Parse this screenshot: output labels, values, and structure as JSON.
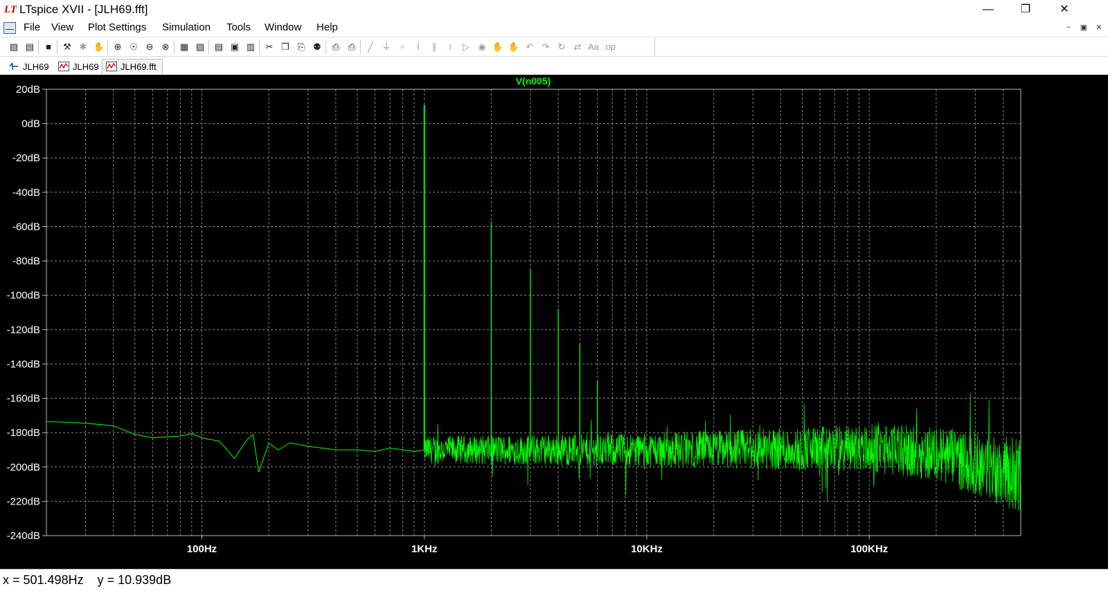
{
  "window": {
    "title": "LTspice XVII - [JLH69.fft]",
    "app_logo": "LT",
    "minimize": "—",
    "restore": "❐",
    "close": "✕"
  },
  "menu": {
    "items": [
      "File",
      "View",
      "Plot Settings",
      "Simulation",
      "Tools",
      "Window",
      "Help"
    ],
    "mdi_minimize": "–",
    "mdi_restore": "▣",
    "mdi_close": "✕"
  },
  "toolbar": {
    "buttons": [
      {
        "icon": "new-schematic-icon",
        "glyph": "▨"
      },
      {
        "icon": "open-icon",
        "glyph": "▤"
      },
      {
        "icon": "save-icon",
        "glyph": "■"
      },
      {
        "icon": "control-panel-icon",
        "glyph": "⚒"
      },
      {
        "icon": "run-icon",
        "glyph": "✱"
      },
      {
        "icon": "halt-icon",
        "glyph": "✋"
      },
      {
        "icon": "zoom-area-icon",
        "glyph": "⊕"
      },
      {
        "icon": "pan-icon",
        "glyph": "☉"
      },
      {
        "icon": "zoom-out-icon",
        "glyph": "⊖"
      },
      {
        "icon": "zoom-fit-icon",
        "glyph": "⊗"
      },
      {
        "icon": "autorange-icon",
        "glyph": "▦"
      },
      {
        "icon": "pick-visible-traces-icon",
        "glyph": "▧"
      },
      {
        "icon": "tile-horizontal-icon",
        "glyph": "▤"
      },
      {
        "icon": "cascade-icon",
        "glyph": "▣"
      },
      {
        "icon": "tile-vertical-icon",
        "glyph": "▥"
      },
      {
        "icon": "cut-icon",
        "glyph": "✂"
      },
      {
        "icon": "copy-icon",
        "glyph": "❐"
      },
      {
        "icon": "paste-icon",
        "glyph": "⎘"
      },
      {
        "icon": "find-icon",
        "glyph": "⚉"
      },
      {
        "icon": "print-preview-icon",
        "glyph": "⎙"
      },
      {
        "icon": "print-icon",
        "glyph": "⎙"
      },
      {
        "icon": "wire-icon",
        "glyph": "╱"
      },
      {
        "icon": "ground-icon",
        "glyph": "⏚"
      },
      {
        "icon": "label-net-icon",
        "glyph": "▫"
      },
      {
        "icon": "resistor-icon",
        "glyph": "⌇"
      },
      {
        "icon": "capacitor-icon",
        "glyph": "∥"
      },
      {
        "icon": "inductor-icon",
        "glyph": "≀"
      },
      {
        "icon": "diode-icon",
        "glyph": "▷"
      },
      {
        "icon": "component-icon",
        "glyph": "◉"
      },
      {
        "icon": "move-icon",
        "glyph": "✋"
      },
      {
        "icon": "drag-icon",
        "glyph": "✋"
      },
      {
        "icon": "undo-icon",
        "glyph": "↶"
      },
      {
        "icon": "redo-icon",
        "glyph": "↷"
      },
      {
        "icon": "rotate-icon",
        "glyph": "↻"
      },
      {
        "icon": "mirror-icon",
        "glyph": "⇄"
      },
      {
        "icon": "text-icon",
        "glyph": "Aa"
      },
      {
        "icon": "spice-directive-icon",
        "glyph": ".op"
      }
    ]
  },
  "tabs": [
    {
      "label": "JLH69",
      "icon": "schematic-icon"
    },
    {
      "label": "JLH69",
      "icon": "waveform-icon"
    },
    {
      "label": "JLH69.fft",
      "icon": "waveform-icon"
    }
  ],
  "colors": {
    "trace": "#00ff00",
    "grid": "#8a8a8a",
    "axis_text": "#ffffff",
    "plot_bg": "#000000"
  },
  "chart_data": {
    "type": "line",
    "title": "V(n005)",
    "xlabel": "",
    "ylabel": "",
    "x_scale": "log",
    "xlim_hz": [
      20,
      480000
    ],
    "ylim_db": [
      -240,
      20
    ],
    "grid": true,
    "x_tick_labels": [
      {
        "value": 100,
        "label": "100Hz"
      },
      {
        "value": 1000,
        "label": "1KHz"
      },
      {
        "value": 10000,
        "label": "10KHz"
      },
      {
        "value": 100000,
        "label": "100KHz"
      }
    ],
    "y_tick_labels": [
      {
        "value": 20,
        "label": "20dB"
      },
      {
        "value": 0,
        "label": "0dB"
      },
      {
        "value": -20,
        "label": "-20dB"
      },
      {
        "value": -40,
        "label": "-40dB"
      },
      {
        "value": -60,
        "label": "-60dB"
      },
      {
        "value": -80,
        "label": "-80dB"
      },
      {
        "value": -100,
        "label": "-100dB"
      },
      {
        "value": -120,
        "label": "-120dB"
      },
      {
        "value": -140,
        "label": "-140dB"
      },
      {
        "value": -160,
        "label": "-160dB"
      },
      {
        "value": -180,
        "label": "-180dB"
      },
      {
        "value": -200,
        "label": "-200dB"
      },
      {
        "value": -220,
        "label": "-220dB"
      },
      {
        "value": -240,
        "label": "-240dB"
      }
    ],
    "series": [
      {
        "name": "V(n005)",
        "floor": [
          [
            20,
            -173.5
          ],
          [
            30,
            -174.5
          ],
          [
            40,
            -176
          ],
          [
            50,
            -181
          ],
          [
            60,
            -183
          ],
          [
            80,
            -182
          ],
          [
            90,
            -180.5
          ],
          [
            100,
            -183
          ],
          [
            120,
            -185
          ],
          [
            130,
            -190
          ],
          [
            140,
            -195
          ],
          [
            160,
            -184
          ],
          [
            170,
            -181
          ],
          [
            180,
            -203
          ],
          [
            200,
            -186
          ],
          [
            220,
            -190
          ],
          [
            250,
            -186
          ],
          [
            300,
            -188
          ],
          [
            350,
            -189
          ],
          [
            400,
            -190
          ],
          [
            500,
            -190
          ],
          [
            600,
            -191
          ],
          [
            700,
            -189
          ],
          [
            800,
            -190
          ],
          [
            900,
            -191
          ],
          [
            1000,
            -190
          ]
        ],
        "harmonics": [
          {
            "freq": 1000,
            "db": 11
          },
          {
            "freq": 2000,
            "db": -57
          },
          {
            "freq": 3000,
            "db": -85
          },
          {
            "freq": 4000,
            "db": -108
          },
          {
            "freq": 5000,
            "db": -128
          },
          {
            "freq": 6000,
            "db": -150
          }
        ],
        "noise_band": {
          "start_hz": 1000,
          "end_hz": 480000,
          "center_db": [
            [
              1000,
              -190
            ],
            [
              10000,
              -190
            ],
            [
              100000,
              -189
            ],
            [
              200000,
              -192
            ],
            [
              480000,
              -205
            ]
          ],
          "spread_db": [
            [
              1000,
              8
            ],
            [
              10000,
              10
            ],
            [
              100000,
              14
            ],
            [
              200000,
              16
            ],
            [
              480000,
              22
            ]
          ]
        }
      }
    ]
  },
  "status": {
    "x_label": "x = ",
    "x_value": "501.498Hz",
    "y_label": "y = ",
    "y_value": "10.939dB"
  }
}
